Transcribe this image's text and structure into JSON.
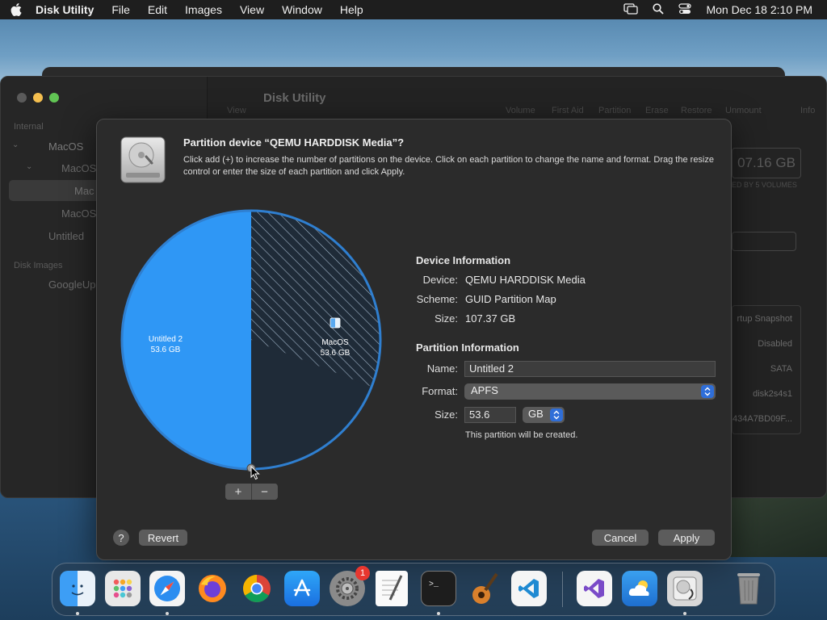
{
  "menubar": {
    "app_name": "Disk Utility",
    "items": [
      "File",
      "Edit",
      "Images",
      "View",
      "Window",
      "Help"
    ],
    "clock": "Mon Dec 18  2:10 PM"
  },
  "background_window": {
    "title": "Disk Utility",
    "sidebar": {
      "internal_label": "Internal",
      "disk_images_label": "Disk Images",
      "items": [
        "MacOS",
        "MacOS",
        "Mac",
        "MacOS",
        "Untitled",
        "GoogleUp"
      ]
    },
    "toolbar": [
      "View",
      "Volume",
      "First Aid",
      "Partition",
      "Erase",
      "Restore",
      "Unmount",
      "Info"
    ],
    "capacity": "07.16 GB",
    "volumes_note": "ED BY 5 VOLUMES",
    "info_values": [
      "rtup Snapshot",
      "Disabled",
      "SATA",
      "disk2s4s1",
      "434A7BD09F..."
    ]
  },
  "sheet": {
    "title": "Partition device “QEMU HARDDISK Media”?",
    "description": "Click add (+) to increase the number of partitions on the device. Click on each partition to change the name and format. Drag the resize control or enter the size of each partition and click Apply.",
    "partitions": [
      {
        "name": "Untitled 2",
        "size": "53.6 GB",
        "color": "#2f97f5"
      },
      {
        "name": "MacOS",
        "size": "53.6 GB",
        "color": "#1f2b38"
      }
    ],
    "add_label": "+",
    "remove_label": "−",
    "device_info": {
      "heading": "Device Information",
      "device_label": "Device:",
      "device_value": "QEMU HARDDISK Media",
      "scheme_label": "Scheme:",
      "scheme_value": "GUID Partition Map",
      "size_label": "Size:",
      "size_value": "107.37 GB"
    },
    "partition_info": {
      "heading": "Partition Information",
      "name_label": "Name:",
      "name_value": "Untitled 2",
      "format_label": "Format:",
      "format_value": "APFS",
      "size_label": "Size:",
      "size_value": "53.6",
      "unit_value": "GB",
      "note": "This partition will be created."
    },
    "help_label": "?",
    "revert_label": "Revert",
    "cancel_label": "Cancel",
    "apply_label": "Apply"
  },
  "dock": {
    "apps": [
      "finder-icon",
      "launchpad-icon",
      "safari-icon",
      "firefox-icon",
      "chrome-icon",
      "app-store-icon",
      "system-preferences-icon",
      "textedit-icon",
      "terminal-icon",
      "garageband-icon",
      "vscode-icon",
      "visual-studio-icon",
      "weather-icon",
      "disk-utility-icon",
      "trash-icon"
    ],
    "badge": "1"
  },
  "colors": {
    "accent": "#2f6ed8",
    "pie_selected": "#2f97f5",
    "pie_other": "#1f2b38"
  }
}
